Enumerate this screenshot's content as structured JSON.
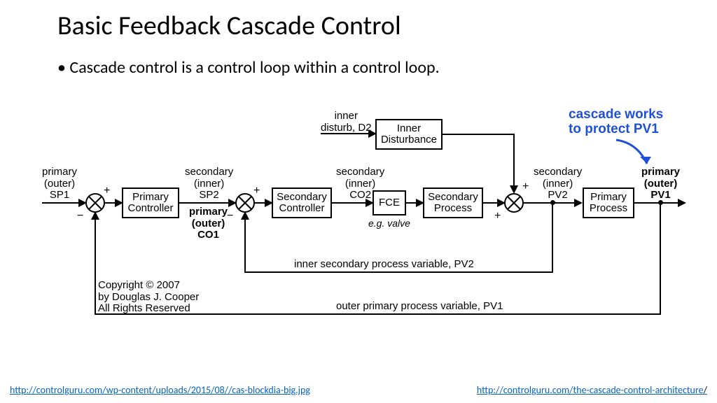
{
  "title": "Basic Feedback Cascade Control",
  "bullet": "Cascade control is a control loop within a control loop.",
  "link_left": "http://controlguru.com/wp-content/uploads/2015/08//cas-blockdia-big.jpg",
  "link_right": "http://controlguru.com/the-cascade-control-architecture",
  "cascade_note": "cascade works\nto protect PV1",
  "labels": {
    "sp1": "primary\n(outer)\nSP1",
    "sp2": "secondary\n(inner)\nSP2",
    "co1": "primary\n(outer)\nCO1",
    "co2": "secondary\n(inner)\nCO2",
    "pv2": "secondary\n(inner)\nPV2",
    "pv1_out": "primary\n(outer)\nPV1",
    "inner_disturb": "inner\ndisturb, D2",
    "eg_valve": "e.g. valve",
    "inner_pv2": "inner secondary process variable, PV2",
    "outer_pv1": "outer primary process variable, PV1",
    "copyright": "Copyright © 2007\nby Douglas J. Cooper\nAll Rights Reserved"
  },
  "blocks": {
    "primary_controller": "Primary\nController",
    "secondary_controller": "Secondary\nController",
    "fce": "FCE",
    "secondary_process": "Secondary\nProcess",
    "primary_process": "Primary\nProcess",
    "inner_disturbance": "Inner\nDisturbance"
  }
}
